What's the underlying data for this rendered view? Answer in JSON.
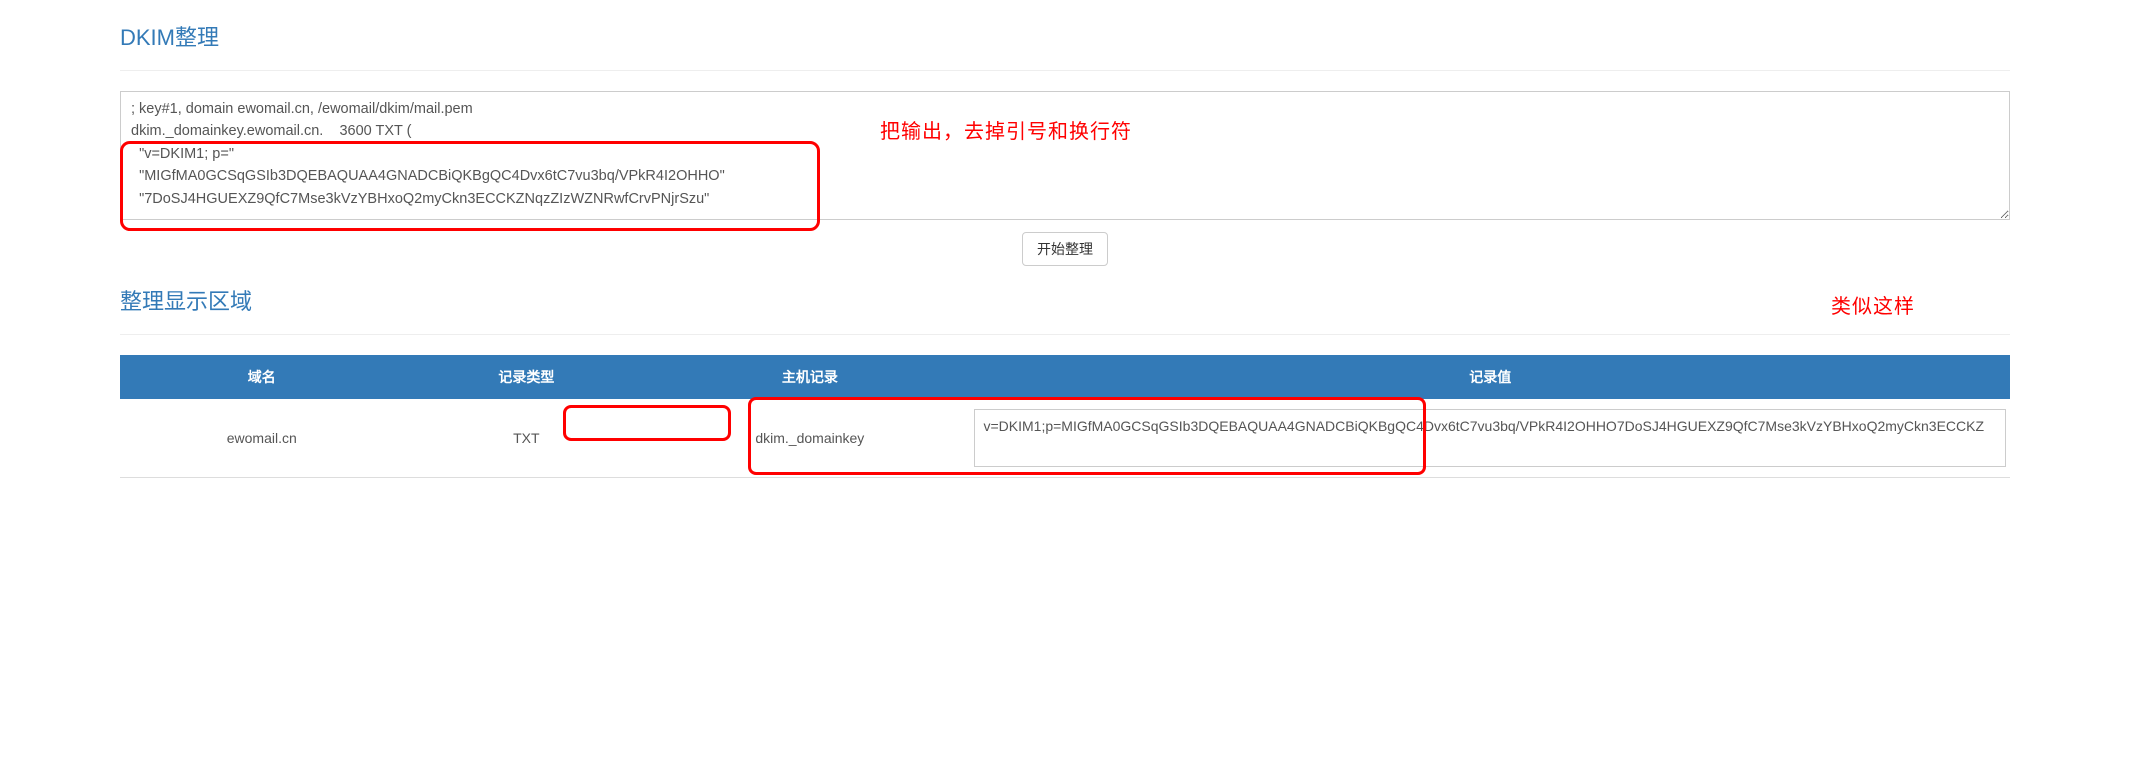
{
  "sections": {
    "dkim_title": "DKIM整理",
    "result_title": "整理显示区域"
  },
  "textarea_content": "; key#1, domain ewomail.cn, /ewomail/dkim/mail.pem\ndkim._domainkey.ewomail.cn.    3600 TXT (\n  \"v=DKIM1; p=\"\n  \"MIGfMA0GCSqGSIb3DQEBAQUAA4GNADCBiQKBgQC4Dvx6tC7vu3bq/VPkR4I2OHHO\"\n  \"7DoSJ4HGUEXZ9QfC7Mse3kVzYBHxoQ2myCkn3ECCKZNqzZIzWZNRwfCrvPNjrSzu\"",
  "annotations": {
    "anno1": "把输出，去掉引号和换行符",
    "anno2": "类似这样"
  },
  "buttons": {
    "start": "开始整理"
  },
  "table": {
    "headers": {
      "domain": "域名",
      "record_type": "记录类型",
      "host": "主机记录",
      "value": "记录值"
    },
    "row": {
      "domain": "ewomail.cn",
      "record_type": "TXT",
      "host": "dkim._domainkey",
      "value": "v=DKIM1;p=MIGfMA0GCSqGSIb3DQEBAQUAA4GNADCBiQKBgQC4Dvx6tC7vu3bq/VPkR4I2OHHO7DoSJ4HGUEXZ9QfC7Mse3kVzYBHxoQ2myCkn3ECCKZ"
    }
  }
}
